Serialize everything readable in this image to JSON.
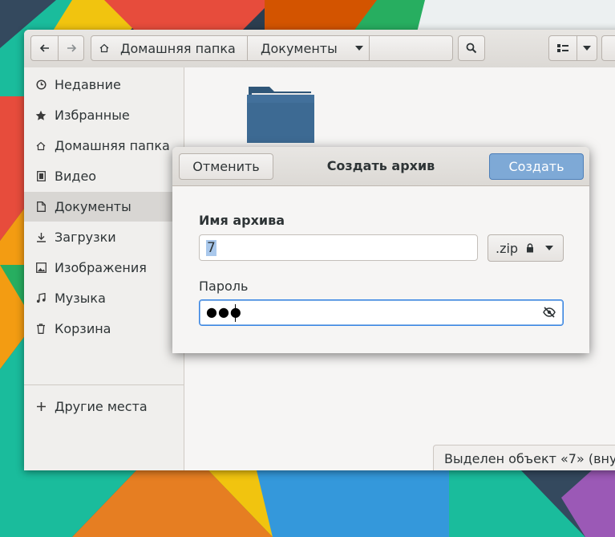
{
  "window": {
    "back_icon": "arrow-left-icon",
    "forward_icon": "arrow-right-icon",
    "path": {
      "home_icon": "home-icon",
      "home_label": "Домашняя папка",
      "current_label": "Документы"
    },
    "search_icon": "search-icon",
    "view_icon": "list-view-icon"
  },
  "sidebar": {
    "items": [
      {
        "label": "Недавние",
        "icon": "clock-icon"
      },
      {
        "label": "Избранные",
        "icon": "star-icon"
      },
      {
        "label": "Домашняя папка",
        "icon": "home-icon"
      },
      {
        "label": "Видео",
        "icon": "film-icon"
      },
      {
        "label": "Документы",
        "icon": "document-icon",
        "active": true
      },
      {
        "label": "Загрузки",
        "icon": "download-icon"
      },
      {
        "label": "Изображения",
        "icon": "image-icon"
      },
      {
        "label": "Музыка",
        "icon": "music-icon"
      },
      {
        "label": "Корзина",
        "icon": "trash-icon"
      }
    ],
    "other_places": {
      "label": "Другие места",
      "icon": "plus-icon"
    }
  },
  "content": {
    "folder_icon": "folder-icon",
    "status": "Выделен объект «7» (вну"
  },
  "dialog": {
    "cancel_label": "Отменить",
    "title": "Создать архив",
    "create_label": "Создать",
    "name_label": "Имя архива",
    "name_value": "7",
    "format_value": ".zip",
    "password_label": "Пароль",
    "password_mask": "●●●",
    "colors": {
      "accent": "#3584e4",
      "create_button": "#7ea9d6"
    }
  }
}
